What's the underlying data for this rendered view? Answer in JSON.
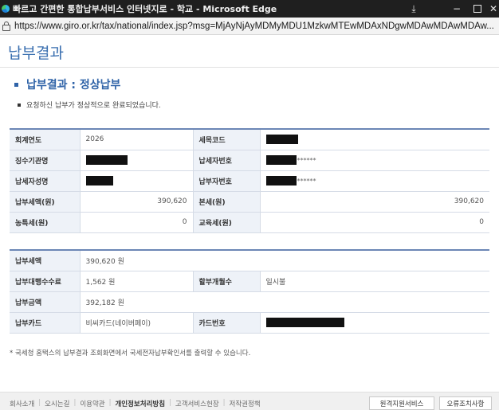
{
  "browser": {
    "title": "빠르고 간편한 통합납부서비스 인터넷지로 - 학교 - Microsoft Edge",
    "url": "https://www.giro.or.kr/tax/national/index.jsp?msg=MjAyNjAyMDMyMDU1MzkwMTEwMDAxNDgwMDAwMDAwMDAw...",
    "controls": {
      "minimize": "−",
      "close": "✕"
    }
  },
  "page": {
    "heading": "납부결과",
    "section_title": "납부결과 : 정상납부",
    "message": "요청하신 납부가 정상적으로 완료되었습니다.",
    "footnote": "* 국세청 홈택스의 납부결과 조회화면에서 국세전자납부확인서를 출력할 수 있습니다."
  },
  "table1": {
    "fiscal_year_label": "회계연도",
    "fiscal_year": "2026",
    "tax_code_label": "세목코드",
    "agency_label": "징수기관명",
    "taxpayer_no_label": "납세자번호",
    "taxpayer_no_suffix": "******",
    "taxpayer_name_label": "납세자성명",
    "payer_no_label": "납부자번호",
    "payer_no_suffix": "******",
    "tax_amount_label": "납부세액(원)",
    "tax_amount": "390,620",
    "principal_label": "본세(원)",
    "principal": "390,620",
    "rural_tax_label": "농특세(원)",
    "rural_tax": "0",
    "edu_tax_label": "교육세(원)",
    "edu_tax": "0"
  },
  "table2": {
    "pay_tax_label": "납부세액",
    "pay_tax": "390,620 원",
    "fee_label": "납부대행수수료",
    "fee": "1,562 원",
    "installment_label": "할부개월수",
    "installment": "일시불",
    "total_label": "납부금액",
    "total": "392,182 원",
    "card_label": "납부카드",
    "card": "비씨카드(네이버페이)",
    "card_no_label": "카드번호"
  },
  "footer": {
    "links": [
      "회사소개",
      "오시는길",
      "이용약관",
      "개인정보처리방침",
      "고객서비스헌장",
      "저작권정책"
    ],
    "remote_button": "원격지원서비스",
    "error_button": "오류조치사항"
  },
  "colors": {
    "accent": "#2f63a8",
    "label_bg": "#eef2f8",
    "table_border": "#6b86b5"
  }
}
